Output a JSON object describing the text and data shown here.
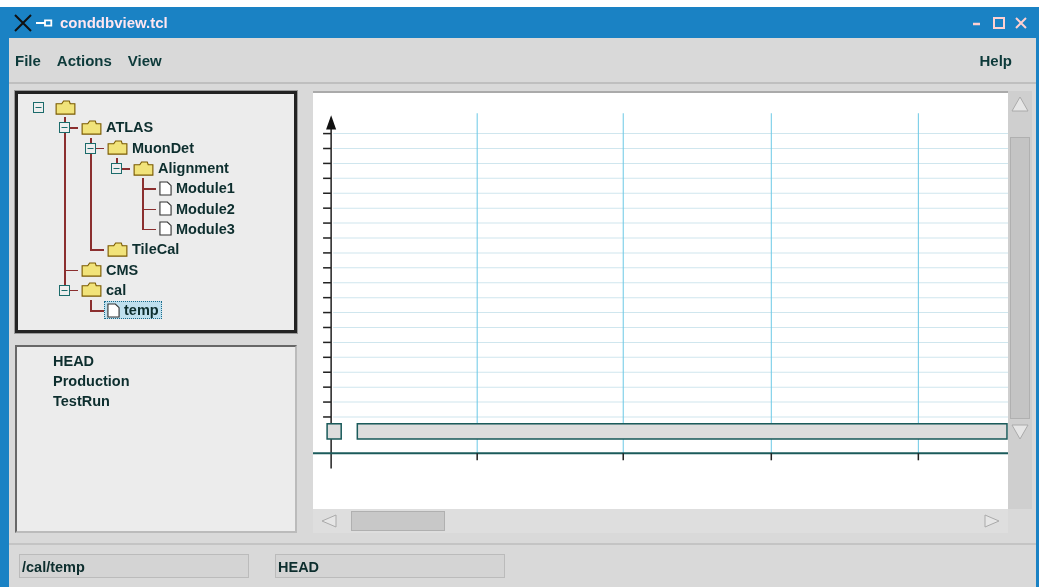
{
  "window": {
    "title": "conddbview.tcl"
  },
  "menu": [
    {
      "label": "File"
    },
    {
      "label": "Actions"
    },
    {
      "label": "View"
    }
  ],
  "help_menu": {
    "label": "Help"
  },
  "tree": [
    {
      "kind": "folder",
      "expanded": true,
      "selected": false,
      "children": [
        {
          "label": "ATLAS",
          "kind": "folder",
          "expanded": true,
          "selected": false,
          "children": [
            {
              "label": "MuonDet",
              "kind": "folder",
              "expanded": true,
              "selected": false,
              "children": [
                {
                  "label": "Alignment",
                  "kind": "folder",
                  "expanded": true,
                  "selected": false,
                  "children": [
                    {
                      "label": "Module1",
                      "kind": "file",
                      "selected": false
                    },
                    {
                      "label": "Module2",
                      "kind": "file",
                      "selected": false
                    },
                    {
                      "label": "Module3",
                      "kind": "file",
                      "selected": false
                    }
                  ]
                }
              ]
            },
            {
              "label": "TileCal",
              "kind": "folder",
              "selected": false
            }
          ]
        },
        {
          "label": "CMS",
          "kind": "folder",
          "selected": false
        },
        {
          "label": "cal",
          "kind": "folder",
          "expanded": true,
          "selected": false,
          "children": [
            {
              "label": "temp",
              "kind": "file",
              "selected": true
            }
          ]
        }
      ]
    }
  ],
  "tags": [
    {
      "label": "HEAD"
    },
    {
      "label": "Production"
    },
    {
      "label": "TestRun"
    }
  ],
  "status_bar": {
    "path": "/cal/temp",
    "tag": "HEAD"
  }
}
